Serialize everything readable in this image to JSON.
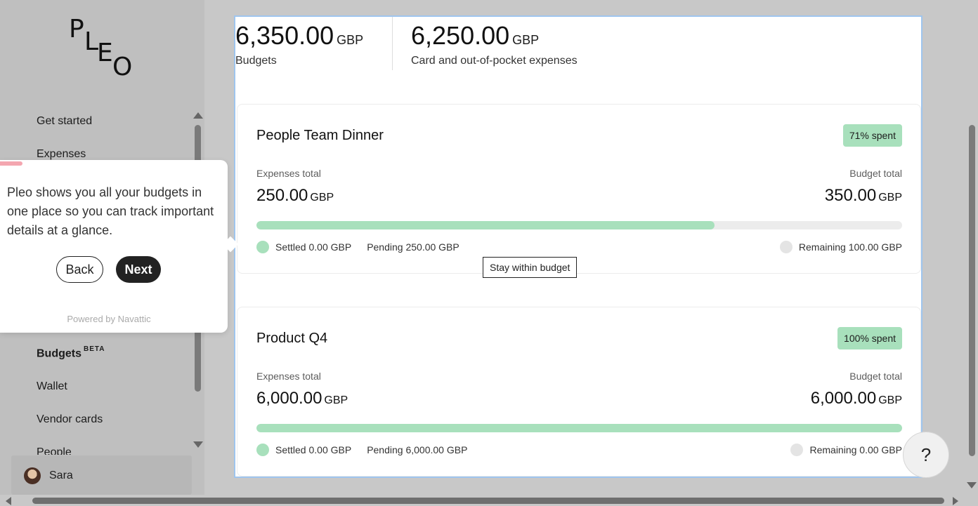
{
  "logo": {
    "letters": [
      "P",
      "L",
      "E",
      "O"
    ]
  },
  "sidebar": {
    "items": [
      {
        "label": "Get started"
      },
      {
        "label": "Expenses"
      },
      {
        "label": "Budgets",
        "badge": "BETA"
      },
      {
        "label": "Wallet"
      },
      {
        "label": "Vendor cards"
      },
      {
        "label": "People"
      }
    ],
    "user": {
      "name": "Sara"
    }
  },
  "summary": {
    "budgets": {
      "amount": "6,350.00",
      "currency": "GBP",
      "label": "Budgets"
    },
    "expenses": {
      "amount": "6,250.00",
      "currency": "GBP",
      "label": "Card and out-of-pocket expenses"
    }
  },
  "budget_cards": [
    {
      "title": "People Team Dinner",
      "badge": "71% spent",
      "expenses_label": "Expenses total",
      "expenses_amount": "250.00",
      "budget_label": "Budget total",
      "budget_amount": "350.00",
      "currency": "GBP",
      "progress": 0.71,
      "settled": "Settled 0.00 GBP",
      "pending": "Pending 250.00 GBP",
      "remaining": "Remaining 100.00 GBP"
    },
    {
      "title": "Product Q4",
      "badge": "100% spent",
      "expenses_label": "Expenses total",
      "expenses_amount": "6,000.00",
      "budget_label": "Budget total",
      "budget_amount": "6,000.00",
      "currency": "GBP",
      "progress": 1.0,
      "settled": "Settled 0.00 GBP",
      "pending": "Pending 6,000.00 GBP",
      "remaining": "Remaining 0.00 GBP"
    }
  ],
  "tooltip": {
    "text": "Stay within budget"
  },
  "walkthrough": {
    "text": "Pleo shows you all your budgets in one place so you can track important details at a glance.",
    "back_label": "Back",
    "next_label": "Next",
    "powered_by": "Powered by Navattic"
  },
  "help": {
    "label": "?"
  },
  "colors": {
    "accent_green": "#a8e0bc",
    "progress_pink": "#f4a6b0",
    "selection_blue": "#9fc5ee"
  }
}
